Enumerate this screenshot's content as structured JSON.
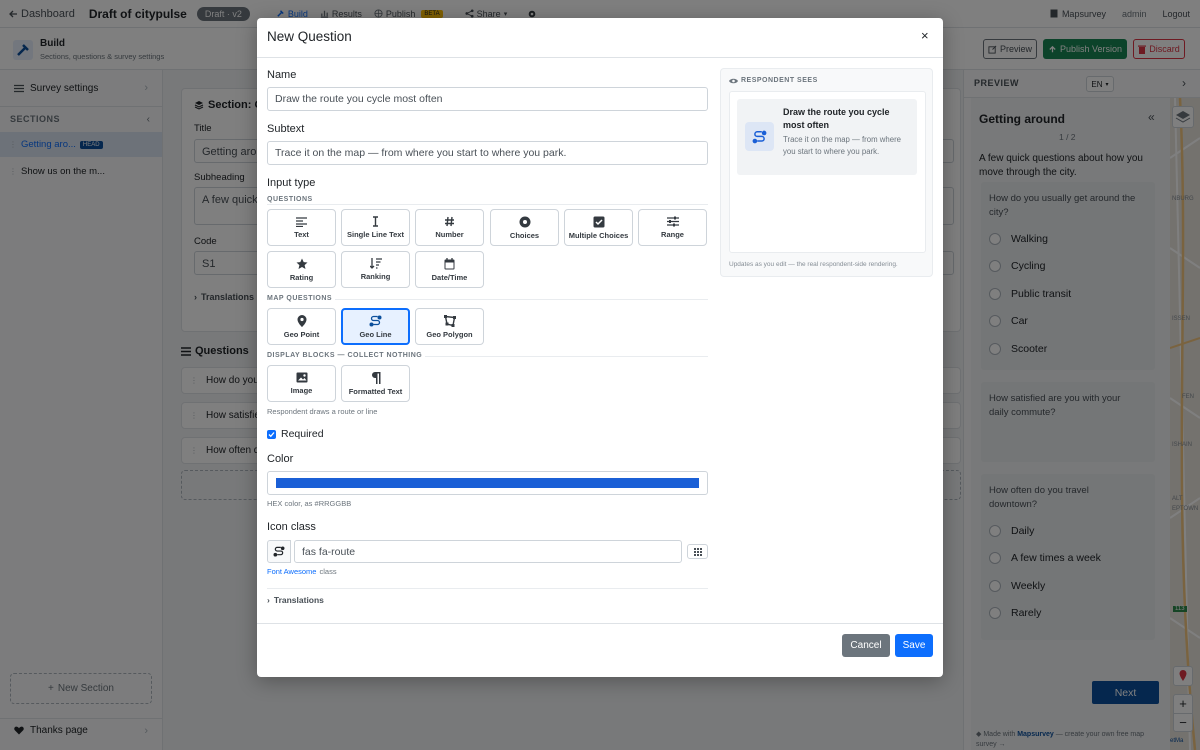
{
  "topbar": {
    "dashboard": "Dashboard",
    "title": "Draft of citypulse",
    "draft_badge": "Draft · v2",
    "tabs": {
      "build": "Build",
      "results": "Results",
      "publish": "Publish",
      "beta": "BETA",
      "share": "Share"
    },
    "brand": "Mapsurvey",
    "user": "admin",
    "logout": "Logout"
  },
  "build_header": {
    "title": "Build",
    "subtitle": "Sections, questions & survey settings",
    "preview_btn": "Preview",
    "publish_btn": "Publish Version",
    "discard_btn": "Discard"
  },
  "sidebar": {
    "survey_settings": "Survey settings",
    "sections_header": "SECTIONS",
    "items": [
      {
        "label": "Getting aro...",
        "badge": "HEAD"
      },
      {
        "label": "Show us on the m..."
      }
    ],
    "new_section": "New Section",
    "thanks_page": "Thanks page"
  },
  "editor": {
    "section_title": "Section: G",
    "title_label": "Title",
    "title_value": "Getting arou",
    "subheading_label": "Subheading",
    "subheading_value": "A few quick",
    "code_label": "Code",
    "code_value": "S1",
    "translations": "Translations",
    "questions_header": "Questions",
    "questions": [
      "How do you",
      "How satisfie",
      "How often do"
    ]
  },
  "modal": {
    "title": "New Question",
    "name_label": "Name",
    "name_value": "Draw the route you cycle most often",
    "subtext_label": "Subtext",
    "subtext_value": "Trace it on the map — from where you start to where you park.",
    "input_type_label": "Input type",
    "questions_section": "QUESTIONS",
    "question_types": [
      "Text",
      "Single Line Text",
      "Number",
      "Choices",
      "Multiple Choices",
      "Range",
      "Rating",
      "Ranking",
      "Date/Time"
    ],
    "map_section": "MAP QUESTIONS",
    "map_types": [
      "Geo Point",
      "Geo Line",
      "Geo Polygon"
    ],
    "display_section": "DISPLAY BLOCKS — COLLECT NOTHING",
    "display_types": [
      "Image",
      "Formatted Text"
    ],
    "selected_type": "Geo Line",
    "type_hint": "Respondent draws a route or line",
    "required_label": "Required",
    "required_checked": true,
    "color_label": "Color",
    "color_value": "#1a5fd6",
    "color_hint": "HEX color, as #RRGGBB",
    "icon_label": "Icon class",
    "icon_value": "fas fa-route",
    "icon_hint_link": "Font Awesome",
    "icon_hint_rest": "class",
    "translations": "Translations",
    "cancel": "Cancel",
    "save": "Save",
    "respondent_header": "RESPONDENT SEES",
    "respondent_title": "Draw the route you cycle most often",
    "respondent_sub": "Trace it on the map — from where you start to where you park.",
    "respondent_footer": "Updates as you edit — the real respondent-side rendering."
  },
  "preview": {
    "header": "PREVIEW",
    "lang": "EN",
    "section_title": "Getting around",
    "page": "1 / 2",
    "intro": "A few quick questions about how you move through the city.",
    "q1": "How do you usually get around the city?",
    "q1_options": [
      "Walking",
      "Cycling",
      "Public transit",
      "Car",
      "Scooter"
    ],
    "q2": "How satisfied are you with your daily commute?",
    "q3": "How often do you travel downtown?",
    "q3_options": [
      "Daily",
      "A few times a week",
      "Weekly",
      "Rarely"
    ],
    "next": "Next",
    "footer_made": "Made with",
    "footer_brand": "Mapsurvey",
    "footer_rest": "— create your own free map survey →",
    "map_labels": [
      "NBURG",
      "ISSEN",
      "FEN",
      "ISHAIN",
      "ALT",
      "EPTOWN",
      "etMa"
    ],
    "map_badge": "113"
  },
  "colors": {
    "primary": "#0d6efd",
    "publish": "#198754",
    "discard": "#dc3545",
    "navy": "#0b4f9c",
    "route": "#1a5fd6"
  }
}
